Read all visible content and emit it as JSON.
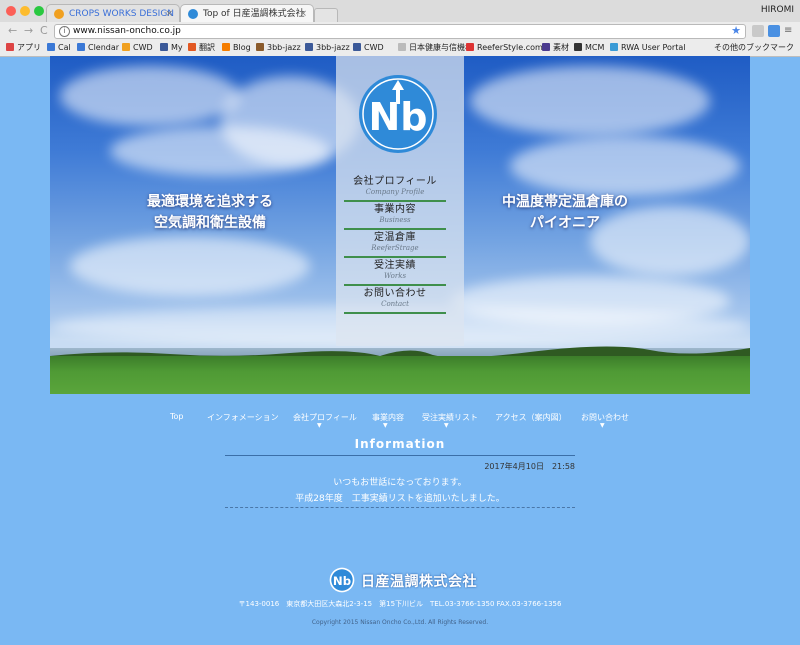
{
  "browser": {
    "tabs": [
      {
        "title": "CROPS WORKS DESIGN",
        "close": "×"
      },
      {
        "title": "Top of 日産温調株式会社",
        "close": "×"
      }
    ],
    "user": "HIROMI",
    "back": "←",
    "forward": "→",
    "reload": "C",
    "url": "www.nissan-oncho.co.jp",
    "info_icon": "i",
    "star": "★",
    "bookmarks": [
      {
        "label": "アプリ",
        "color": "#d44"
      },
      {
        "label": "Cal",
        "color": "#3a78d6"
      },
      {
        "label": "Clendar",
        "color": "#3a78d6"
      },
      {
        "label": "CWD",
        "color": "#f0a020"
      },
      {
        "label": "My",
        "color": "#3b5998"
      },
      {
        "label": "翻訳",
        "color": "#e25822"
      },
      {
        "label": "Blog",
        "color": "#f57d00"
      },
      {
        "label": "3bb-jazz",
        "color": "#8a5a2b"
      },
      {
        "label": "3bb-jazz",
        "color": "#3b5998"
      },
      {
        "label": "CWD",
        "color": "#3b5998"
      },
      {
        "label": "日本健康与信機構",
        "color": "#bbb"
      },
      {
        "label": "ReeferStyle.com",
        "color": "#d33"
      },
      {
        "label": "素材",
        "color": "#4b3b8f"
      },
      {
        "label": "MCM",
        "color": "#333"
      },
      {
        "label": "RWA User Portal",
        "color": "#3a9bd6"
      }
    ],
    "other_bookmarks": "その他のブックマーク"
  },
  "hero": {
    "left_line1": "最適環境を追求する",
    "left_line2": "空気調和衛生設備",
    "right_line1": "中温度帯定温倉庫の",
    "right_line2": "パイオニア",
    "logo_text": "Nb",
    "menu": [
      {
        "jp": "会社プロフィール",
        "en": "Company Profile"
      },
      {
        "jp": "事業内容",
        "en": "Business"
      },
      {
        "jp": "定温倉庫",
        "en": "ReeferStrage"
      },
      {
        "jp": "受注実績",
        "en": "Works"
      },
      {
        "jp": "お問い合わせ",
        "en": "Contact"
      }
    ]
  },
  "nav": {
    "items": [
      "Top",
      "インフォメーション",
      "会社プロフィール",
      "事業内容",
      "受注実績リスト",
      "アクセス（案内図）",
      "お問い合わせ"
    ],
    "arrow": "▼"
  },
  "information": {
    "title": "Information",
    "date": "2017年4月10日　21:58",
    "line1": "いつもお世話になっております。",
    "line2": "平成28年度　工事実績リストを追加いたしました。"
  },
  "footer": {
    "company": "日産温調株式会社",
    "address": "〒143-0016　東京都大田区大森北2-3-15　第15下川ビル　TEL.03-3766-1350 FAX.03-3766-1356",
    "copyright": "Copyright 2015 Nissan Oncho Co.,Ltd. All Rights Reserved."
  },
  "colors": {
    "page_bg": "#7ab8f3",
    "accent_green": "#3f8f4c",
    "logo_blue": "#2f8ad8"
  }
}
